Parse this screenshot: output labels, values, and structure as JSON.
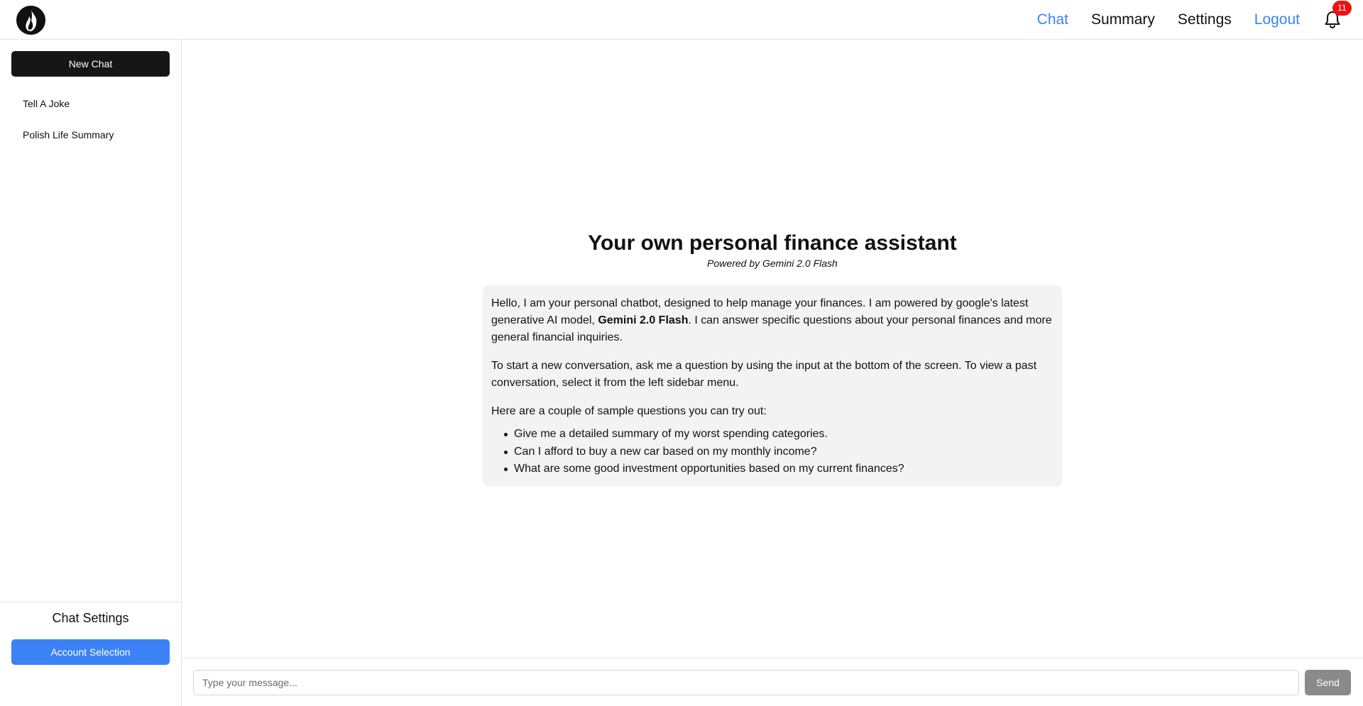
{
  "header": {
    "logo_icon": "flame-logo-icon",
    "nav": {
      "chat": "Chat",
      "summary": "Summary",
      "settings": "Settings",
      "logout": "Logout"
    },
    "notifications": {
      "icon": "bell-icon",
      "count": "11"
    },
    "colors": {
      "active_link": "#3b82f6",
      "badge": "#ef1111"
    }
  },
  "sidebar": {
    "new_chat_label": "New Chat",
    "chats": [
      "Tell A Joke",
      "Polish Life Summary"
    ],
    "footer": {
      "title": "Chat Settings",
      "account_button_label": "Account Selection"
    }
  },
  "main": {
    "title": "Your own personal finance assistant",
    "subtitle": "Powered by Gemini 2.0 Flash",
    "welcome": {
      "p1_before": "Hello, I am your personal chatbot, designed to help manage your finances. I am powered by google's latest generative AI model, ",
      "p1_bold": "Gemini 2.0 Flash",
      "p1_after": ". I can answer specific questions about your personal finances and more general financial inquiries.",
      "p2": "To start a new conversation, ask me a question by using the input at the bottom of the screen. To view a past conversation, select it from the left sidebar menu.",
      "p3": "Here are a couple of sample questions you can try out:",
      "samples": [
        "Give me a detailed summary of my worst spending categories.",
        "Can I afford to buy a new car based on my monthly income?",
        "What are some good investment opportunities based on my current finances?"
      ]
    }
  },
  "composer": {
    "placeholder": "Type your message...",
    "value": "",
    "send_label": "Send"
  }
}
